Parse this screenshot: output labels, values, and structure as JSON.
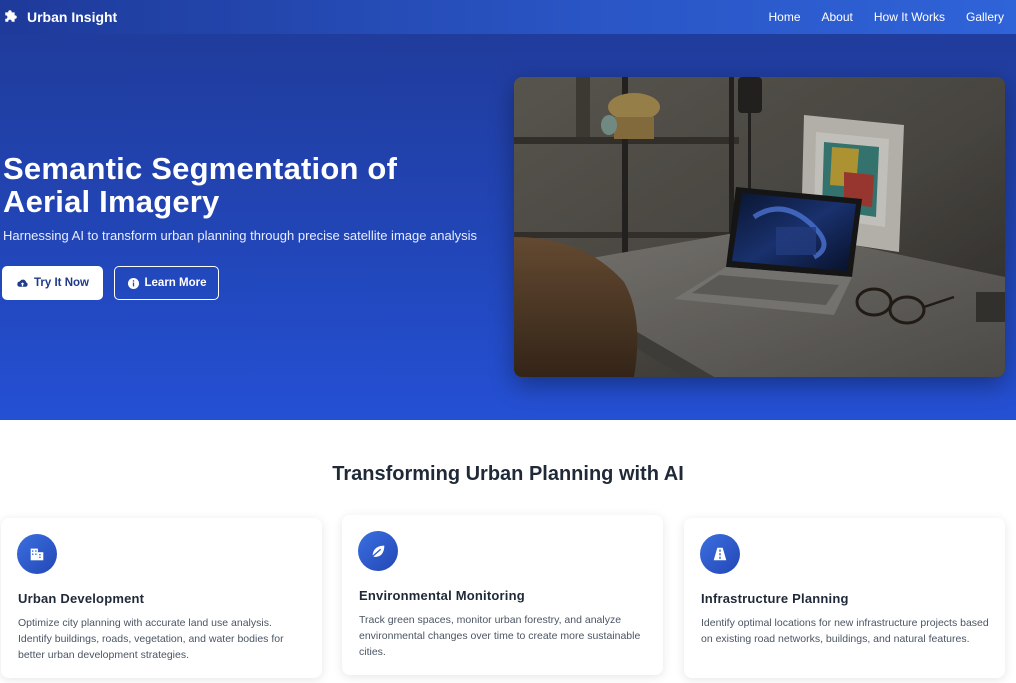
{
  "navbar": {
    "brand": "Urban Insight",
    "brand_icon": "puzzle-icon",
    "links": [
      {
        "label": "Home"
      },
      {
        "label": "About"
      },
      {
        "label": "How It Works"
      },
      {
        "label": "Gallery"
      }
    ]
  },
  "hero": {
    "title": "Semantic Segmentation of Aerial Imagery",
    "subtitle": "Harnessing AI to transform urban planning through precise satellite image analysis",
    "primary_button": {
      "label": "Try It Now",
      "icon": "cloud-upload-icon"
    },
    "secondary_button": {
      "label": "Learn More",
      "icon": "info-circle-icon"
    },
    "image_alt": "laptop on desk photo"
  },
  "features": {
    "title": "Transforming Urban Planning with AI",
    "cards": [
      {
        "icon": "building-icon",
        "title": "Urban Development",
        "text": "Optimize city planning with accurate land use analysis. Identify buildings, roads, vegetation, and water bodies for better urban development strategies."
      },
      {
        "icon": "leaf-icon",
        "title": "Environmental Monitoring",
        "text": "Track green spaces, monitor urban forestry, and analyze environmental changes over time to create more sustainable cities."
      },
      {
        "icon": "road-icon",
        "title": "Infrastructure Planning",
        "text": "Identify optimal locations for new infrastructure projects based on existing road networks, buildings, and natural features."
      }
    ]
  },
  "colors": {
    "nav_start": "#1e3a9a",
    "nav_end": "#2f63d8",
    "hero_top": "#203c9c",
    "hero_bottom": "#2450d4",
    "accent": "#2347b5",
    "heading": "#1f2937",
    "body_text": "#4b5563"
  }
}
